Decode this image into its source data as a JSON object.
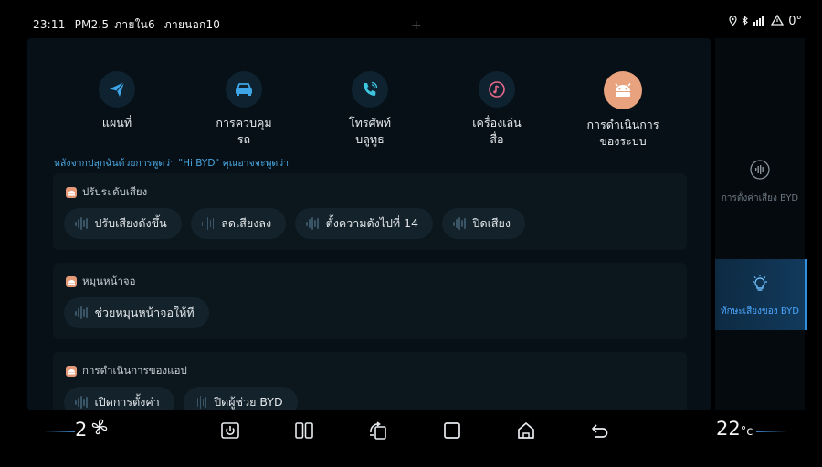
{
  "status": {
    "time": "23:11",
    "pm25": "PM2.5",
    "inside": "ภายใน6",
    "outside": "ภายนอก10",
    "temperature": "0°"
  },
  "apps": [
    {
      "label": "แผนที่",
      "icon": "send-icon"
    },
    {
      "label": "การควบคุม\nรถ",
      "icon": "car-icon"
    },
    {
      "label": "โทรศัพท์\nบลูทูธ",
      "icon": "phone-icon"
    },
    {
      "label": "เครื่องเล่น\nสื่อ",
      "icon": "music-icon"
    },
    {
      "label": "การดำเนินการ\nของระบบ",
      "icon": "android-icon"
    }
  ],
  "hint": "หลังจากปลุกฉันด้วยการพูดว่า \"Hi BYD\" คุณอาจจะพูดว่า",
  "cards": [
    {
      "title": "ปรับระดับเสียง",
      "chips": [
        "ปรับเสียงดังขึ้น",
        "ลดเสียงลง",
        "ตั้งความดังไปที่ 14",
        "ปิดเสียง"
      ]
    },
    {
      "title": "หมุนหน้าจอ",
      "chips": [
        "ช่วยหมุนหน้าจอให้ที"
      ]
    },
    {
      "title": "การดำเนินการของแอป",
      "chips": [
        "เปิดการตั้งค่า",
        "ปิดผู้ช่วย BYD"
      ]
    }
  ],
  "side": {
    "settings_label": "การตั้งค่าเสียง BYD",
    "skills_label": "ทักษะเสียงของ BYD"
  },
  "bottom": {
    "fan_level": "2",
    "temp_value": "22",
    "temp_unit": "°c"
  },
  "colors": {
    "accent": "#4aa6ff",
    "app_bg": "#0e2230",
    "orange": "#e8a27e"
  }
}
